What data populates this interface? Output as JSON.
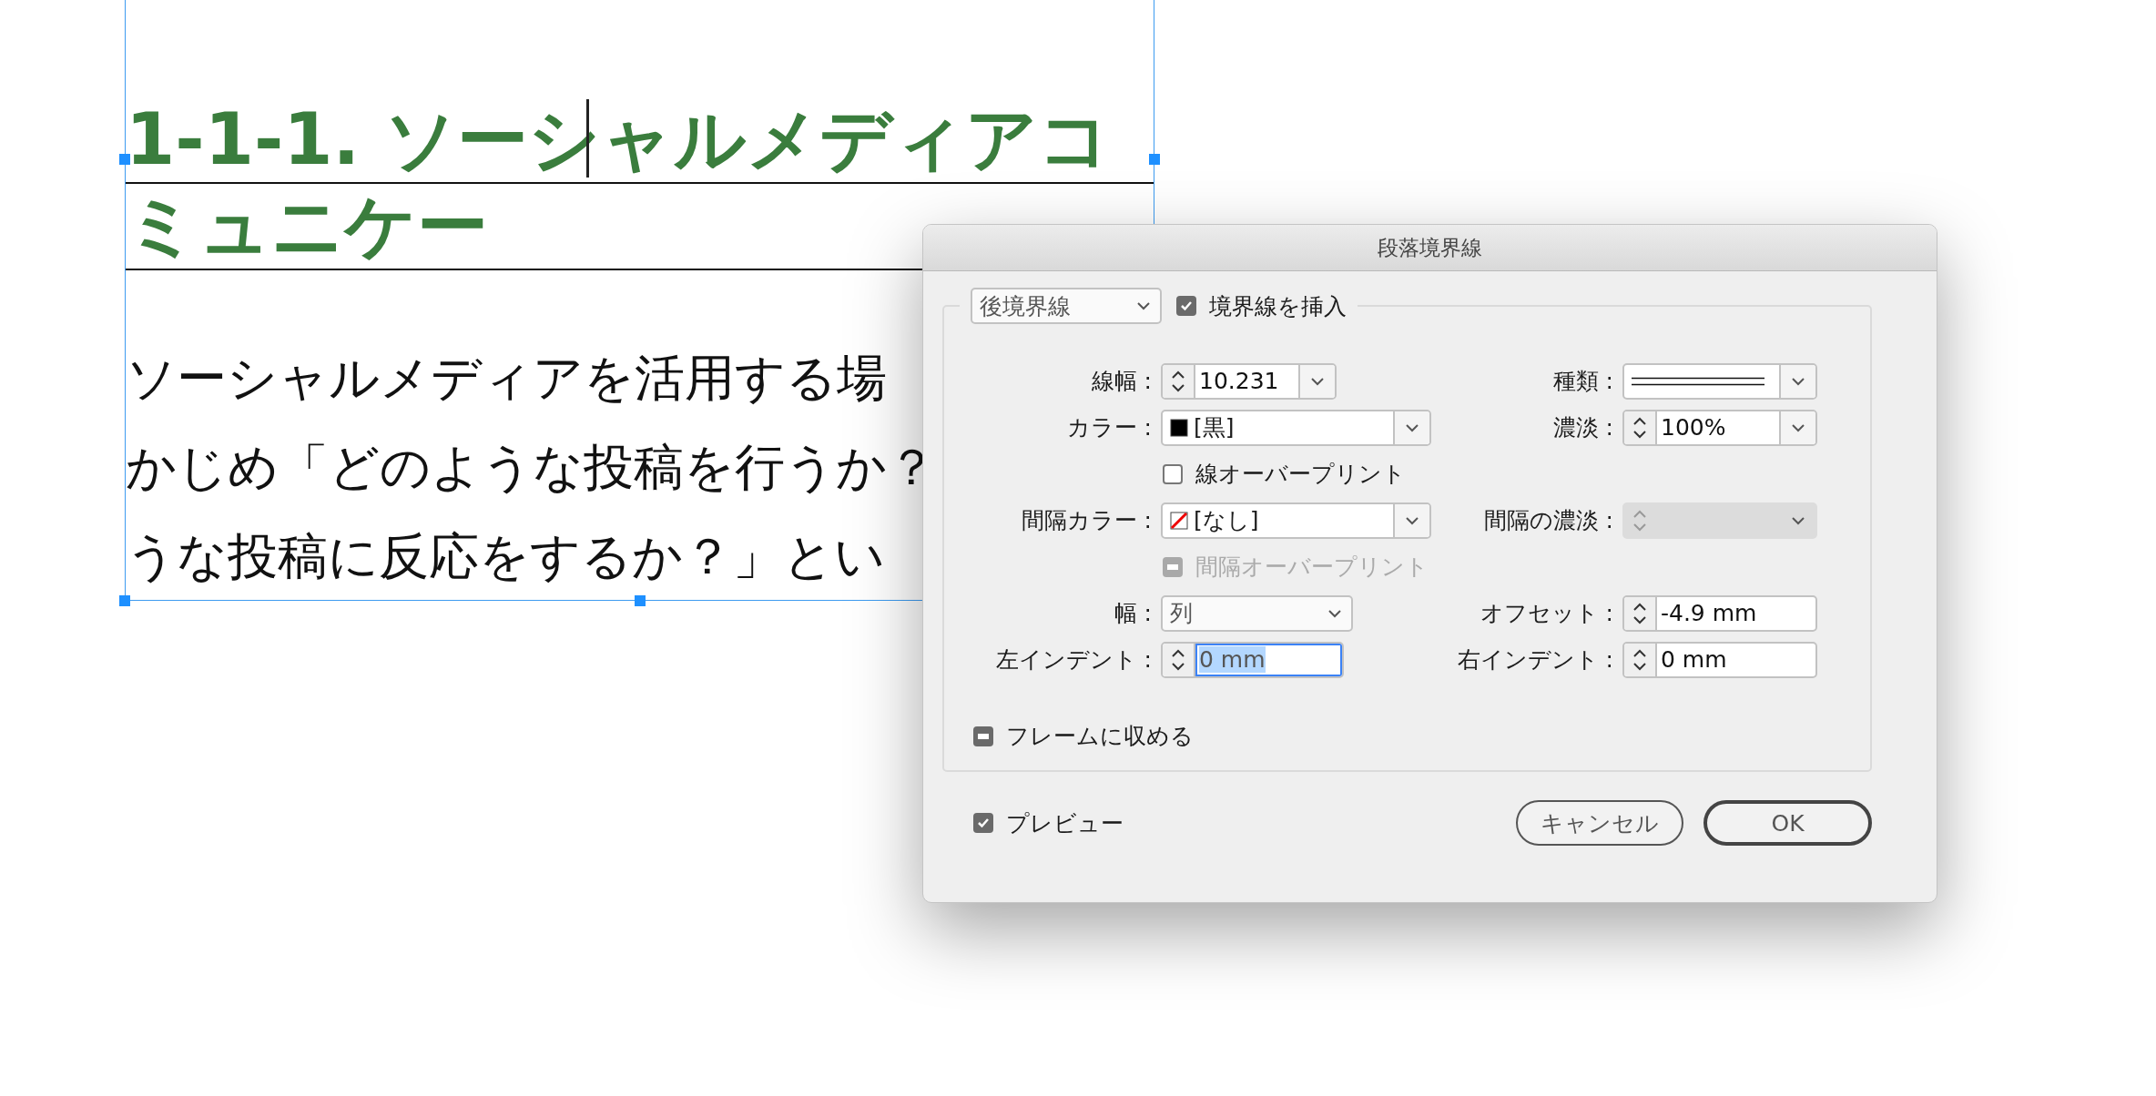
{
  "document": {
    "heading_lines": [
      "1-1-1. ソーシャルメディアコ",
      "ミュニケー"
    ],
    "body_lines": [
      "ソーシャルメディアを活用する場",
      "かじめ「どのような投稿を行うか？",
      "うな投稿に反応をするか？」とい"
    ]
  },
  "dialog": {
    "title": "段落境界線",
    "rule_position": "後境界線",
    "insert_rule": {
      "label": "境界線を挿入",
      "checked": true,
      "disabled": false
    },
    "rows": [
      {
        "cells": [
          {
            "kind": "spinner",
            "label": "線幅 :",
            "value": "10.231",
            "dropdown": true,
            "focused": false,
            "disabled": false
          },
          {
            "kind": "line_dropdown",
            "label": "種類 :",
            "double": true
          }
        ]
      },
      {
        "cells": [
          {
            "kind": "swatch_dropdown",
            "label": "カラー :",
            "no_color": false,
            "value": "[黒]"
          },
          {
            "kind": "spinner",
            "label": "濃淡 :",
            "value": "100%",
            "dropdown": true,
            "focused": false,
            "disabled": false
          }
        ]
      },
      {
        "cells": [
          {
            "kind": "checkbox",
            "label": "線オーバープリント",
            "checked": false,
            "disabled": false
          }
        ]
      },
      {
        "cells": [
          {
            "kind": "swatch_dropdown",
            "label": "間隔カラー :",
            "no_color": true,
            "value": "[なし]"
          },
          {
            "kind": "spinner",
            "label": "間隔の濃淡 :",
            "dropdown": true,
            "focused": false,
            "disabled": true
          }
        ]
      },
      {
        "cells": [
          {
            "kind": "checkbox",
            "label": "間隔オーバープリント",
            "checked": true,
            "indeterminate": true,
            "disabled": true
          }
        ]
      },
      {
        "cells": [
          {
            "kind": "dropdown",
            "label": "幅 :",
            "value": "列"
          },
          {
            "kind": "spinner",
            "label": "オフセット :",
            "value": "-4.9 mm",
            "dropdown": false,
            "focused": false,
            "disabled": false
          }
        ]
      },
      {
        "cells": [
          {
            "kind": "spinner",
            "label": "左インデント :",
            "value": "0 mm",
            "dropdown": false,
            "focused": true,
            "disabled": false
          },
          {
            "kind": "spinner",
            "label": "右インデント :",
            "value": "0 mm",
            "dropdown": false,
            "focused": false,
            "disabled": false
          }
        ]
      }
    ],
    "fit_to_frame": {
      "label": "フレームに収める",
      "checked": true,
      "indeterminate": true,
      "disabled": false
    },
    "preview": {
      "label": "プレビュー",
      "checked": true,
      "disabled": false
    },
    "buttons": [
      {
        "label": "キャンセル",
        "default": false
      },
      {
        "label": "OK",
        "default": true
      }
    ]
  }
}
